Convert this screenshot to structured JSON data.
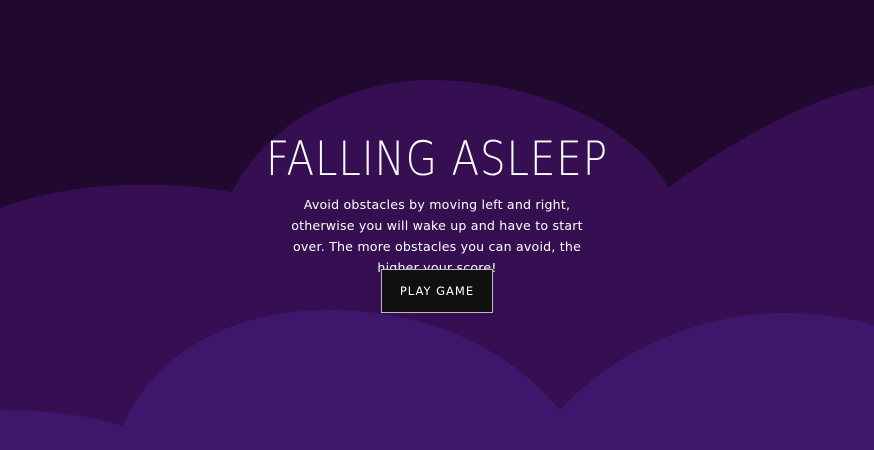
{
  "game": {
    "title": "FALLING ASLEEP",
    "description": "Avoid obstacles by moving left and right, otherwise you will wake up and have to start over. The more obstacles you can avoid, the higher your score!",
    "play_button_label": "PLAY GAME"
  },
  "colors": {
    "sky": "#21082f",
    "back_cloud": "#360f52",
    "front_cloud": "#3e166b",
    "button_background": "#111011",
    "button_border": "#bfb7c6",
    "text": "#ffffff"
  }
}
